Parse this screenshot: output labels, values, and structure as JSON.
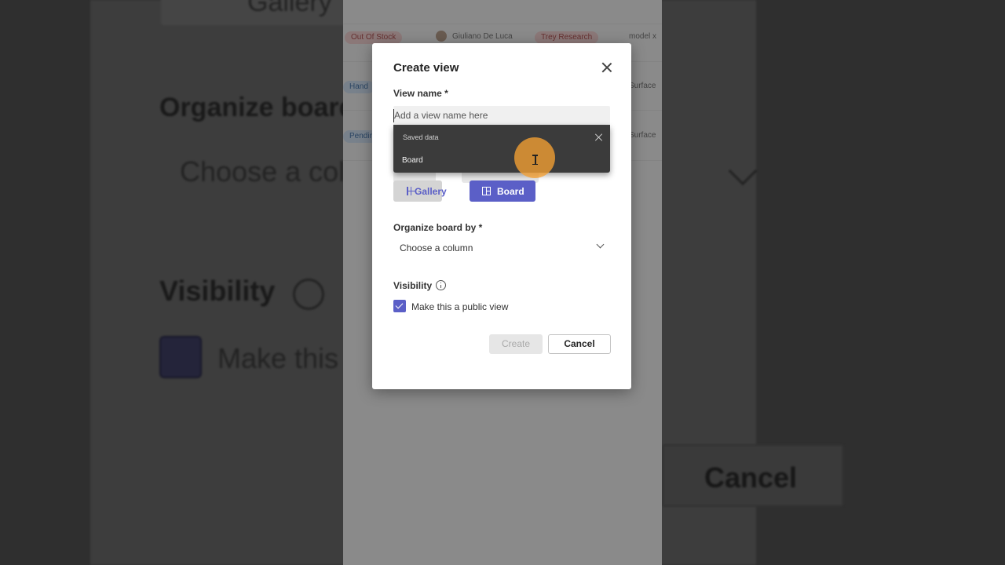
{
  "background_app": {
    "row1": {
      "status": "Out Of Stock",
      "person": "Giuliano De Luca",
      "company": "Trey Research",
      "product": "model x"
    },
    "row2": {
      "tag": "Hand",
      "product": "Surface"
    },
    "row3": {
      "tag": "Pending",
      "product": "Surface"
    }
  },
  "dialog": {
    "title": "Create view",
    "view_name_label": "View name *",
    "view_name_placeholder": "Add a view name here",
    "view_name_value": "",
    "autocomplete": {
      "header": "Saved data",
      "items": [
        "Board"
      ]
    },
    "layout_options": [
      {
        "label": "Gallery",
        "icon": "gallery-grid-icon",
        "selected": false
      },
      {
        "label": "Board",
        "icon": "board-layout-icon",
        "selected": true
      }
    ],
    "organize_label": "Organize board by *",
    "organize_value": "Choose a column",
    "visibility_label": "Visibility",
    "public_view_label": "Make this a public view",
    "public_view_checked": true,
    "create_label": "Create",
    "cancel_label": "Cancel"
  },
  "colors": {
    "accent": "#5b5fc7",
    "cursor_highlight": "#f5a032",
    "autocomplete_bg": "#3b3b3b"
  }
}
